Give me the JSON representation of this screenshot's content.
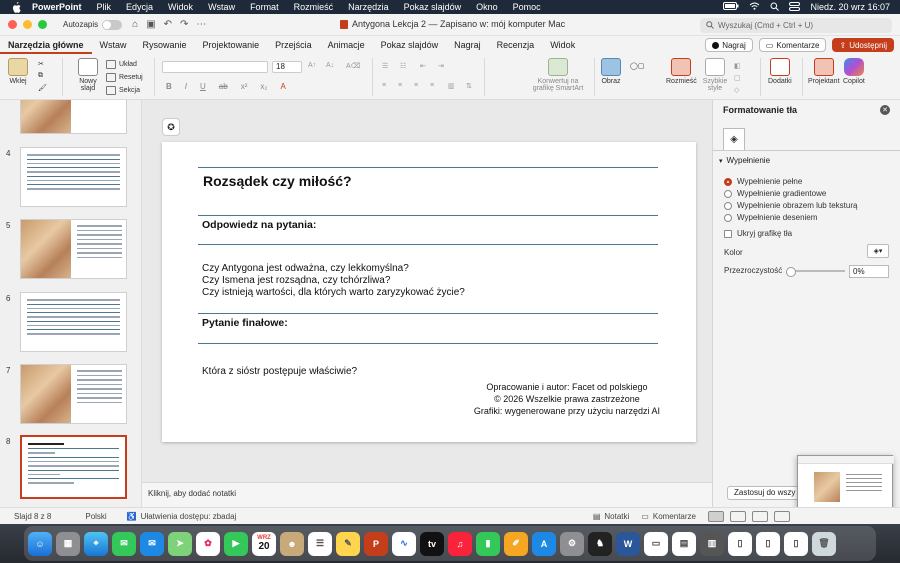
{
  "menubar": {
    "app": "PowerPoint",
    "items": [
      "Plik",
      "Edycja",
      "Widok",
      "Wstaw",
      "Format",
      "Rozmieść",
      "Narzędzia",
      "Pokaz slajdów",
      "Okno",
      "Pomoc"
    ],
    "clock": "Niedz. 20 wrz  16:07"
  },
  "titlebar": {
    "autosave_label": "Autozapis",
    "doc_title": "Antygona Lekcja 2 — Zapisano w: mój komputer Mac",
    "search_placeholder": "Wyszukaj (Cmd + Ctrl + U)"
  },
  "tabs": {
    "items": [
      "Narzędzia główne",
      "Wstaw",
      "Rysowanie",
      "Projektowanie",
      "Przejścia",
      "Animacje",
      "Pokaz slajdów",
      "Nagraj",
      "Recenzja",
      "Widok"
    ],
    "record": "Nagraj",
    "comments": "Komentarze",
    "share": "Udostępnij"
  },
  "ribbon": {
    "paste": "Wklej",
    "new_slide": "Nowy slajd",
    "layout": "Układ",
    "reset": "Resetuj",
    "section": "Sekcja",
    "font_size": "18",
    "smartart": "Konwertuj na grafikę SmartArt",
    "image": "Obraz",
    "arrange": "Rozmieść",
    "quick_styles": "Szybkie style",
    "addins": "Dodatki",
    "designer": "Projektant",
    "copilot": "Copilot"
  },
  "thumbnails": {
    "numbers": [
      "4",
      "5",
      "6",
      "7",
      "8"
    ]
  },
  "slide": {
    "title": "Rozsądek czy miłość?",
    "h1": "Odpowiedz na pytania:",
    "q1": "Czy Antygona jest odważna, czy lekkomyślna?",
    "q2": "Czy Ismena jest rozsądna, czy tchórzliwa?",
    "q3": "Czy istnieją wartości, dla których warto zaryzykować życie?",
    "h2": "Pytanie finałowe:",
    "final_q": "Która z sióstr postępuje właściwie?",
    "credit1": "Opracowanie i autor: Facet od polskiego",
    "credit2": "© 2026 Wszelkie prawa zastrzeżone",
    "credit3": "Grafiki: wygenerowane przy użyciu narzędzi AI"
  },
  "notes_placeholder": "Kliknij, aby dodać notatki",
  "pane": {
    "title": "Formatowanie tła",
    "section": "Wypełnienie",
    "options": [
      "Wypełnienie pełne",
      "Wypełnienie gradientowe",
      "Wypełnienie obrazem lub teksturą",
      "Wypełnienie deseniem"
    ],
    "hide_graphics": "Ukryj grafikę tła",
    "color_label": "Kolor",
    "transparency_label": "Przezroczystość",
    "transparency_value": "0%",
    "apply_all": "Zastosuj do wszy"
  },
  "status": {
    "slide": "Slajd 8 z 8",
    "language": "Polski",
    "accessibility": "Ułatwienia dostępu: zbadaj",
    "notes": "Notatki",
    "comments": "Komentarze"
  },
  "dock": {
    "calendar_month": "WRZ",
    "calendar_day": "20"
  },
  "colors": {
    "accent": "#c43e1c",
    "rule": "#4a7a8c"
  }
}
